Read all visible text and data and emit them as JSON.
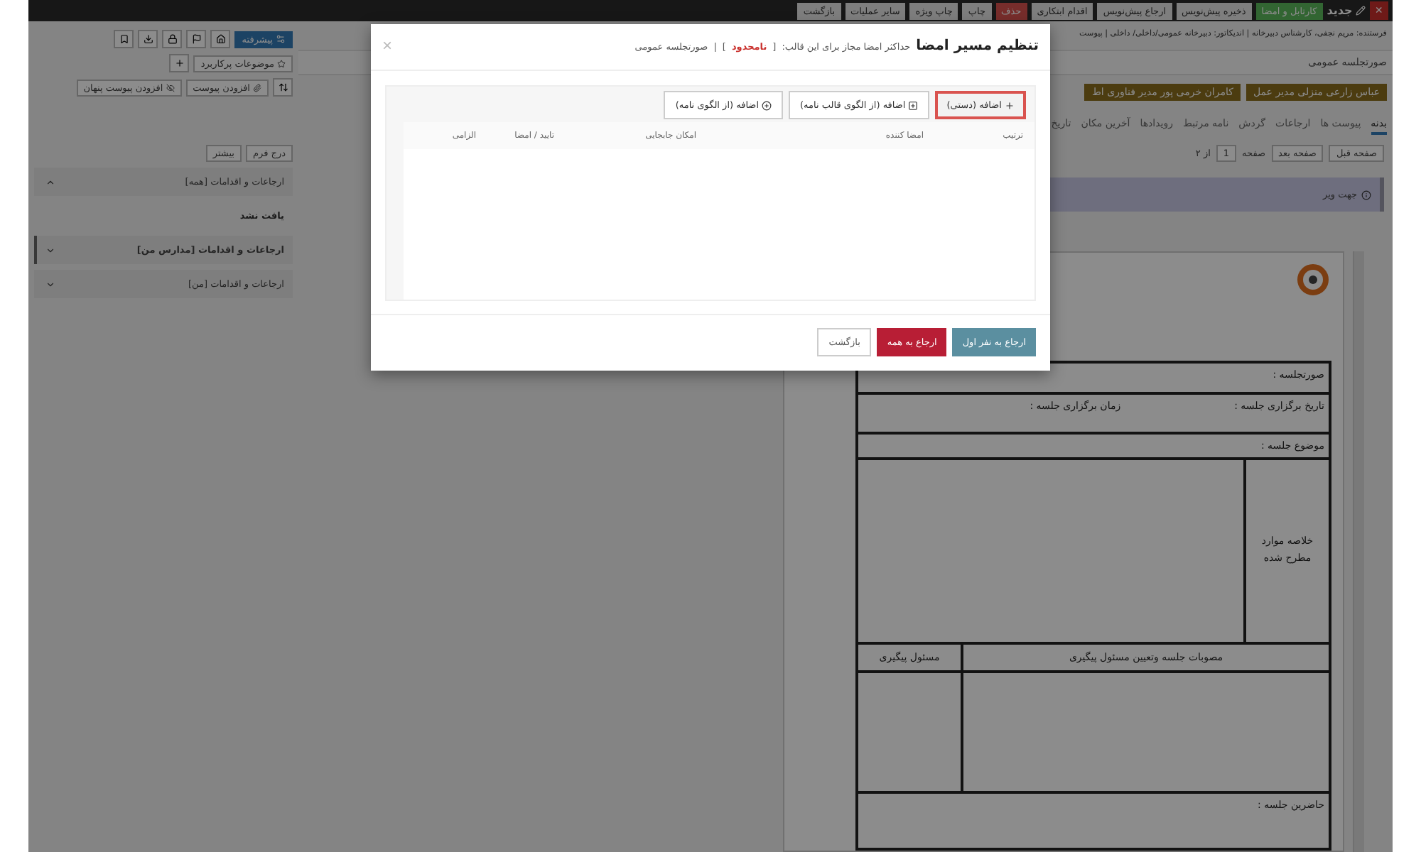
{
  "top_bar": {
    "close": "×",
    "title": "جدید",
    "actions": [
      {
        "label": "کارتابل و امضا",
        "kind": "success"
      },
      {
        "label": "ذخیره پیش‌نویس",
        "kind": "default"
      },
      {
        "label": "ارجاع پیش‌نویس",
        "kind": "default"
      },
      {
        "label": "اقدام ابتکاری",
        "kind": "default"
      },
      {
        "label": "حذف",
        "kind": "danger"
      },
      {
        "label": "چاپ",
        "kind": "default"
      },
      {
        "label": "چاپ ویژه",
        "kind": "default"
      },
      {
        "label": "سایر عملیات",
        "kind": "default"
      },
      {
        "label": "بازگشت",
        "kind": "default"
      }
    ]
  },
  "sender": "فرستنده: مریم نجفی، کارشناس دبیرخانه | اندیکاتور: دبیرخانه عمومی/داخلی/ داخلی | پیوست",
  "sidebar": {
    "advanced_button": "پیشرفته",
    "topics_button": "موضوعات پرکاربرد",
    "attach_button": "افزودن پیوست",
    "hidden_attach_button": "افزودن پیوست پنهان",
    "more_button": "بیشتر",
    "form_button": "درج فرم",
    "sections": [
      {
        "title": "ارجاعات و اقدامات [همه]",
        "expanded": true,
        "selected": false,
        "content": "یافت نشد"
      },
      {
        "title": "ارجاعات و اقدامات [مدارس من]",
        "expanded": false,
        "selected": true
      },
      {
        "title": "ارجاعات و اقدامات [من]",
        "expanded": false,
        "selected": false
      }
    ]
  },
  "document_title": "صورتجلسه عمومی",
  "recipients": [
    "عباس زارعی منزلی مدیر عمل",
    "کامران خرمی پور مدیر فناوری اط"
  ],
  "tabs": [
    {
      "label": "بدنه",
      "selected": true
    },
    {
      "label": "پیوست ها",
      "selected": false
    },
    {
      "label": "ارجاعات",
      "selected": false
    },
    {
      "label": "گردش",
      "selected": false
    },
    {
      "label": "نامه مرتبط",
      "selected": false
    },
    {
      "label": "رویدادها",
      "selected": false
    },
    {
      "label": "آخرین مکان",
      "selected": false
    },
    {
      "label": "تاریخ",
      "selected": false
    }
  ],
  "pager": {
    "prev": "صفحه قبل",
    "next": "صفحه بعد",
    "page_label": "صفحه",
    "page": "1",
    "of": "از ۲"
  },
  "info": "جهت ویر",
  "document": {
    "meeting": "صورتجلسه :",
    "date": "تاریخ برگزاری جلسه :",
    "time": "زمان برگزاری جلسه :",
    "subject": "موضوع جلسه :",
    "summary": "خلاصه موارد مطرح شده",
    "resolutions": "مصوبات جلسه وتعیین مسئول پیگیری",
    "responsible": "مسئول پیگیری",
    "attendees": "حاضرین جلسه :"
  },
  "modal": {
    "title": "تنظیم مسیر امضا",
    "note": "حداکثر امضا مجاز برای این قالب:",
    "bracket_open": "[",
    "limit": "نامحدود",
    "bracket_close": "]",
    "separator": "|",
    "template": "صورتجلسه عمومی",
    "close": "×",
    "add_buttons": [
      {
        "label": "اضافه (دستی)",
        "highlighted": true
      },
      {
        "label": "اضافه (از الگوی قالب نامه)",
        "highlighted": false
      },
      {
        "label": "اضافه (از الگوی نامه)",
        "highlighted": false
      }
    ],
    "columns": [
      "ترتیب",
      "امضا کننده",
      "امکان جابجایی",
      "تایید / امضا",
      "الزامی"
    ],
    "footer_buttons": [
      {
        "label": "ارجاع به نفر اول",
        "kind": "info"
      },
      {
        "label": "ارجاع به همه",
        "kind": "danger"
      },
      {
        "label": "بازگشت",
        "kind": "default"
      }
    ]
  }
}
